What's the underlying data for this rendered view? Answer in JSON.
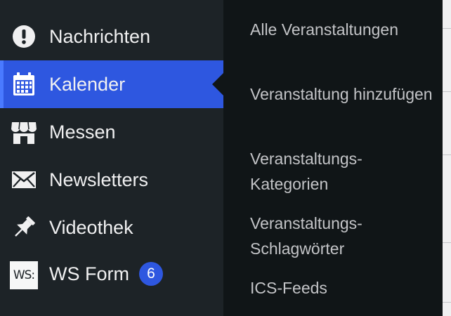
{
  "sidebar": {
    "items": [
      {
        "label": "Nachrichten",
        "icon": "alert-icon"
      },
      {
        "label": "Kalender",
        "icon": "calendar-icon",
        "active": true
      },
      {
        "label": "Messen",
        "icon": "store-icon"
      },
      {
        "label": "Newsletters",
        "icon": "envelope-icon"
      },
      {
        "label": "Videothek",
        "icon": "pin-icon"
      },
      {
        "label": "WS Form",
        "icon": "ws-form-logo",
        "logo_text": "WS:",
        "badge": "6"
      }
    ]
  },
  "submenu": {
    "items": [
      {
        "label": "Alle Veranstaltungen"
      },
      {
        "label": "Veranstaltung hinzufügen"
      },
      {
        "label": "Veranstaltungs-Kategorien"
      },
      {
        "label": "Veranstaltungs-Schlagwörter"
      },
      {
        "label": "ICS-Feeds"
      }
    ]
  },
  "colors": {
    "sidebar_bg": "#1d2327",
    "submenu_bg": "#101517",
    "active_bg": "#2e57e0",
    "badge_bg": "#2e57e0",
    "text": "#f0f0f1",
    "submenu_text": "#c3c4c7"
  }
}
